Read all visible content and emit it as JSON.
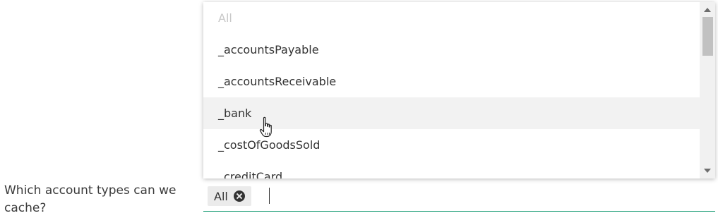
{
  "question": {
    "label": "Which account types can we cache?"
  },
  "select": {
    "chips": [
      {
        "label": "All"
      }
    ],
    "input_value": ""
  },
  "dropdown": {
    "options": [
      {
        "label": "All",
        "state": "disabled"
      },
      {
        "label": "_accountsPayable",
        "state": "normal"
      },
      {
        "label": "_accountsReceivable",
        "state": "normal"
      },
      {
        "label": "_bank",
        "state": "hover"
      },
      {
        "label": "_costOfGoodsSold",
        "state": "normal"
      },
      {
        "label": "_creditCard",
        "state": "normal"
      }
    ]
  },
  "colors": {
    "accent_underline": "#21a07a",
    "hover_bg": "#f2f2f2",
    "disabled_text": "#c8c8c8",
    "chip_bg": "#ebebeb"
  },
  "icons": {
    "chip_remove": "close-circle-icon",
    "cursor": "hand-pointer-icon"
  }
}
